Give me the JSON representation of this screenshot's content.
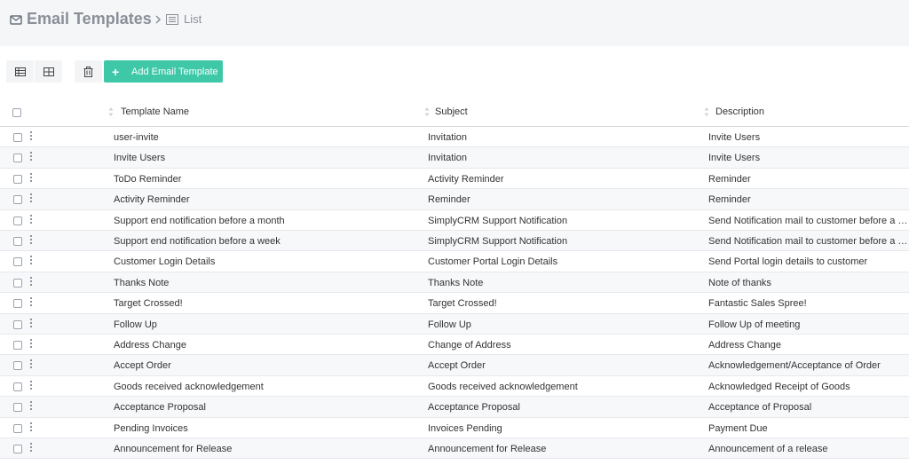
{
  "header": {
    "title": "Email Templates",
    "breadcrumb": "List"
  },
  "toolbar": {
    "add_label": "Add Email Template"
  },
  "table": {
    "columns": [
      "Template Name",
      "Subject",
      "Description"
    ],
    "rows": [
      {
        "name": "user-invite",
        "subject": "Invitation",
        "description": "Invite Users"
      },
      {
        "name": "Invite Users",
        "subject": "Invitation",
        "description": "Invite Users"
      },
      {
        "name": "ToDo Reminder",
        "subject": "Activity Reminder",
        "description": "Reminder"
      },
      {
        "name": "Activity Reminder",
        "subject": "Reminder",
        "description": "Reminder"
      },
      {
        "name": "Support end notification before a month",
        "subject": "SimplyCRM Support Notification",
        "description": "Send Notification mail to customer before a m..."
      },
      {
        "name": "Support end notification before a week",
        "subject": "SimplyCRM Support Notification",
        "description": "Send Notification mail to customer before a w..."
      },
      {
        "name": "Customer Login Details",
        "subject": "Customer Portal Login Details",
        "description": "Send Portal login details to customer"
      },
      {
        "name": "Thanks Note",
        "subject": "Thanks Note",
        "description": "Note of thanks"
      },
      {
        "name": "Target Crossed!",
        "subject": "Target Crossed!",
        "description": "Fantastic Sales Spree!"
      },
      {
        "name": "Follow Up",
        "subject": "Follow Up",
        "description": "Follow Up of meeting"
      },
      {
        "name": "Address Change",
        "subject": "Change of Address",
        "description": "Address Change"
      },
      {
        "name": "Accept Order",
        "subject": "Accept Order",
        "description": "Acknowledgement/Acceptance of Order"
      },
      {
        "name": "Goods received acknowledgement",
        "subject": "Goods received acknowledgement",
        "description": "Acknowledged Receipt of Goods"
      },
      {
        "name": "Acceptance Proposal",
        "subject": "Acceptance Proposal",
        "description": "Acceptance of Proposal"
      },
      {
        "name": "Pending Invoices",
        "subject": "Invoices Pending",
        "description": "Payment Due"
      },
      {
        "name": "Announcement for Release",
        "subject": "Announcement for Release",
        "description": "Announcement of a release"
      }
    ]
  },
  "colors": {
    "accent": "#3ec8a8",
    "header_bg": "#f5f6f8",
    "title": "#8a8f98"
  },
  "icons": [
    "envelope-icon",
    "chevron-right-icon",
    "list-icon",
    "list-view-icon",
    "grid-view-icon",
    "trash-icon",
    "plus-icon",
    "sort-icon",
    "kebab-icon"
  ]
}
